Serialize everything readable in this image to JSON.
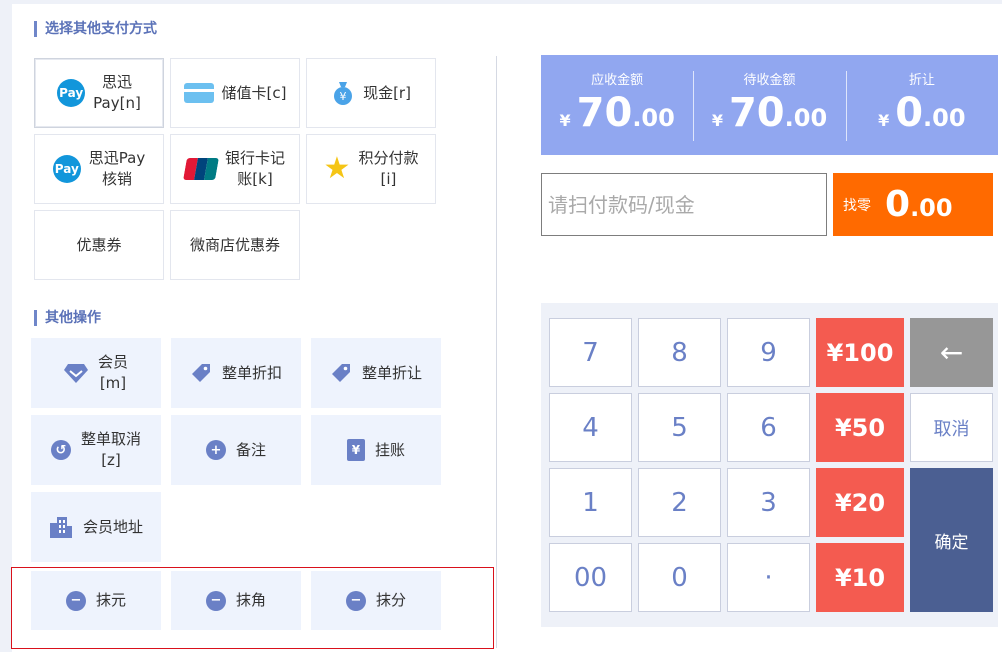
{
  "payment_section": {
    "title": "选择其他支付方式",
    "methods": [
      {
        "label": "思迅\nPay[n]",
        "icon": "pay-icon",
        "icon_text": "Pay"
      },
      {
        "label": "储值卡[c]",
        "icon": "card-icon"
      },
      {
        "label": "现金[r]",
        "icon": "money-bag-icon",
        "icon_text": "¥"
      },
      {
        "label": "思迅Pay\n核销",
        "icon": "pay-icon",
        "icon_text": "Pay"
      },
      {
        "label": "银行卡记\n账[k]",
        "icon": "unionpay-icon"
      },
      {
        "label": "积分付款\n[i]",
        "icon": "star-icon"
      },
      {
        "label": "优惠券"
      },
      {
        "label": "微商店优惠券"
      }
    ]
  },
  "other_section": {
    "title": "其他操作",
    "ops": [
      {
        "label": "会员\n[m]",
        "icon": "diamond-icon"
      },
      {
        "label": "整单折扣",
        "icon": "tag-icon"
      },
      {
        "label": "整单折让",
        "icon": "tag-icon"
      },
      {
        "label": "整单取消\n[z]",
        "icon": "undo-icon",
        "icon_text": "↺"
      },
      {
        "label": "备注",
        "icon": "plus-icon",
        "icon_text": "+"
      },
      {
        "label": "挂账",
        "icon": "ledger-icon",
        "icon_text": "¥"
      },
      {
        "label": "会员地址",
        "icon": "building-icon"
      },
      {
        "label": "抹元",
        "icon": "minus-icon",
        "icon_text": "−"
      },
      {
        "label": "抹角",
        "icon": "minus-icon",
        "icon_text": "−"
      },
      {
        "label": "抹分",
        "icon": "minus-icon",
        "icon_text": "−"
      }
    ]
  },
  "summary": {
    "currency": "¥",
    "receivable": {
      "label": "应收金额",
      "int": "70",
      "dec": ".00"
    },
    "pending": {
      "label": "待收金额",
      "int": "70",
      "dec": ".00"
    },
    "discount": {
      "label": "折让",
      "int": "0",
      "dec": ".00"
    }
  },
  "scan": {
    "placeholder": "请扫付款码/现金",
    "value": ""
  },
  "change": {
    "label": "找零",
    "int": "0",
    "dec": ".00"
  },
  "keypad": {
    "keys": [
      "7",
      "8",
      "9",
      "4",
      "5",
      "6",
      "1",
      "2",
      "3",
      "00",
      "0",
      "·"
    ],
    "money": [
      "¥100",
      "¥50",
      "¥20",
      "¥10"
    ],
    "back": "←",
    "cancel": "取消",
    "confirm": "确定"
  },
  "colors": {
    "accent": "#6a80c6",
    "summary_bg": "#91a7f0",
    "change_bg": "#ff6a00",
    "money_key": "#f45b50",
    "confirm_key": "#4b5f92",
    "highlight_border": "#d9111b"
  }
}
